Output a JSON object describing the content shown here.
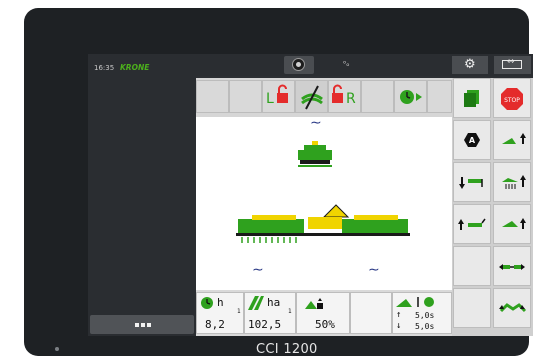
{
  "status_bar": {
    "time": "16:35",
    "brand": "KRONE"
  },
  "top_controls": {
    "signal_icon": "signal-icon",
    "settings_icon": "gear-icon",
    "swap_icon": "screen-swap-icon"
  },
  "toolbar": {
    "icons": [
      "lock-left-icon",
      "no-pass-icon",
      "lock-right-icon",
      "play-icon"
    ],
    "labels": {
      "left": "L",
      "right": "R"
    }
  },
  "metrics": {
    "hours": {
      "unit": "h",
      "subscript": "1",
      "value": "8,2"
    },
    "area": {
      "unit": "ha",
      "subscript": "1",
      "value": "102,5"
    },
    "percent": {
      "value": "50%"
    },
    "timers": {
      "up": "5,0s",
      "down": "5,0s"
    }
  },
  "bottom_menu": {
    "label": "menu"
  },
  "device": {
    "brand": "CCI 1200"
  },
  "colors": {
    "accent_green": "#2fa11e",
    "machine_yellow": "#f0d400",
    "stop_red": "#e42b2b",
    "wave_blue": "#2b3a86"
  }
}
